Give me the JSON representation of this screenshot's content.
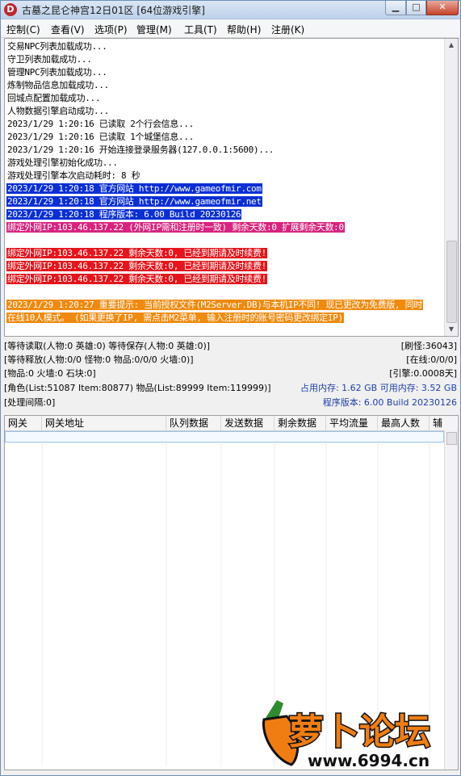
{
  "window": {
    "title": "古墓之昆仑神宫12日01区 [64位游戏引擎]",
    "icon_letter": "D",
    "controls": [
      "minimize-icon",
      "maximize-icon",
      "close-icon"
    ]
  },
  "menu": [
    {
      "label": "控制(C)"
    },
    {
      "label": "查看(V)"
    },
    {
      "label": "选项(P)"
    },
    {
      "label": "管理(M)"
    },
    {
      "label": "工具(T)"
    },
    {
      "label": "帮助(H)"
    },
    {
      "label": "注册(K)"
    }
  ],
  "log": [
    {
      "text": "交易NPC列表加载成功...",
      "style": ""
    },
    {
      "text": "守卫列表加载成功...",
      "style": ""
    },
    {
      "text": "管理NPC列表加载成功...",
      "style": ""
    },
    {
      "text": "炼制物品信息加载成功...",
      "style": ""
    },
    {
      "text": "回城点配置加载成功...",
      "style": ""
    },
    {
      "text": "人物数据引擎启动成功...",
      "style": ""
    },
    {
      "text": "2023/1/29 1:20:16 已读取 2个行会信息...",
      "style": ""
    },
    {
      "text": "2023/1/29 1:20:16 已读取 1个城堡信息...",
      "style": ""
    },
    {
      "text": "2023/1/29 1:20:16 开始连接登录服务器(127.0.0.1:5600)...",
      "style": ""
    },
    {
      "text": "游戏处理引擎初始化成功...",
      "style": ""
    },
    {
      "text": "游戏处理引擎本次启动耗时: 8 秒",
      "style": ""
    },
    {
      "text": "2023/1/29 1:20:18 官方网站 http://www.gameofmir.com",
      "style": "hl-blue"
    },
    {
      "text": "2023/1/29 1:20:18 官方网站 http://www.gameofmir.net",
      "style": "hl-blue"
    },
    {
      "text": "2023/1/29 1:20:18 程序版本: 6.00 Build 20230126",
      "style": "hl-blue"
    },
    {
      "text": "绑定外网IP:103.46.137.22 (外网IP需和注册时一致) 剩余天数:0 扩展剩余天数:0",
      "style": "hl-pink"
    },
    {
      "text": "",
      "style": ""
    },
    {
      "text": "绑定外网IP:103.46.137.22 剩余天数:0, 已经到期请及时续费!",
      "style": "hl-red"
    },
    {
      "text": "绑定外网IP:103.46.137.22 剩余天数:0, 已经到期请及时续费!",
      "style": "hl-red"
    },
    {
      "text": "绑定外网IP:103.46.137.22 剩余天数:0, 已经到期请及时续费!",
      "style": "hl-red"
    },
    {
      "text": "",
      "style": ""
    },
    {
      "text": "2023/1/29 1:20:27 重要提示: 当前授权文件(M2Server.DB)与本机IP不同! 现已更改为免费版, 同时",
      "style": "hl-orange"
    },
    {
      "text": "在线10人模式。 (如果更换了IP, 需点击M2菜单, 输入注册时的账号密码更改绑定IP)",
      "style": "hl-orange"
    }
  ],
  "status": {
    "row1_left": "[等待读取(人物:0 英雄:0) 等待保存(人物:0 英雄:0)]",
    "row1_right": "[刷怪:36043]",
    "row2_left": "[等待释放(人物:0/0 怪物:0 物品:0/0/0 火墙:0)]",
    "row2_right": "[在线:0/0/0]",
    "row3_left": "[物品:0 火墙:0 石块:0]",
    "row3_right": "[引擎:0.0008天]",
    "row4_left": "[角色(List:51087 Item:80877) 物品(List:89999 Item:119999)]",
    "row4_mem": "占用内存: 1.62 GB 可用内存: 3.52 GB",
    "row5_left": "[处理间隔:0]",
    "row5_right": "程序版本: 6.00 Build 20230126"
  },
  "grid": {
    "columns": [
      "网关",
      "网关地址",
      "队列数据",
      "发送数据",
      "剩余数据",
      "平均流量",
      "最高人数",
      "辅"
    ]
  },
  "watermark": {
    "brand": "萝卜论坛",
    "url": "www.6994.cn"
  },
  "colors": {
    "highlight_blue": "#0a2fd6",
    "highlight_pink": "#d8247e",
    "highlight_red": "#e5151b",
    "highlight_orange": "#f08a0e",
    "status_blue_text": "#1d3fa8"
  }
}
